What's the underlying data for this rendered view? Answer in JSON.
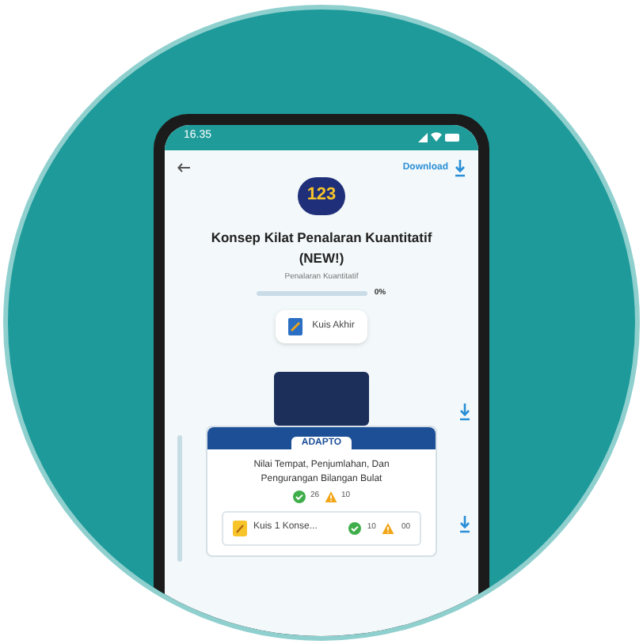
{
  "status_bar": {
    "time": "16.35"
  },
  "header": {
    "download_label": "Download"
  },
  "course": {
    "logo_text": "123",
    "title": "Konsep Kilat Penalaran Kuantitatif (NEW!)",
    "subtitle": "Penalaran Kuantitatif",
    "progress": {
      "level": 0,
      "reading": "0%"
    },
    "final_quiz": "Kuis Akhir"
  },
  "module": {
    "badge": "ADAPTO",
    "title": "Nilai Tempat, Penjumlahan, Dan Pengurangan Bilangan Bulat",
    "correct_count": "26",
    "warning_count": "10",
    "quiz": {
      "label": "Kuis 1 Konse...",
      "correct_count": "10",
      "warning_count": "00"
    }
  }
}
